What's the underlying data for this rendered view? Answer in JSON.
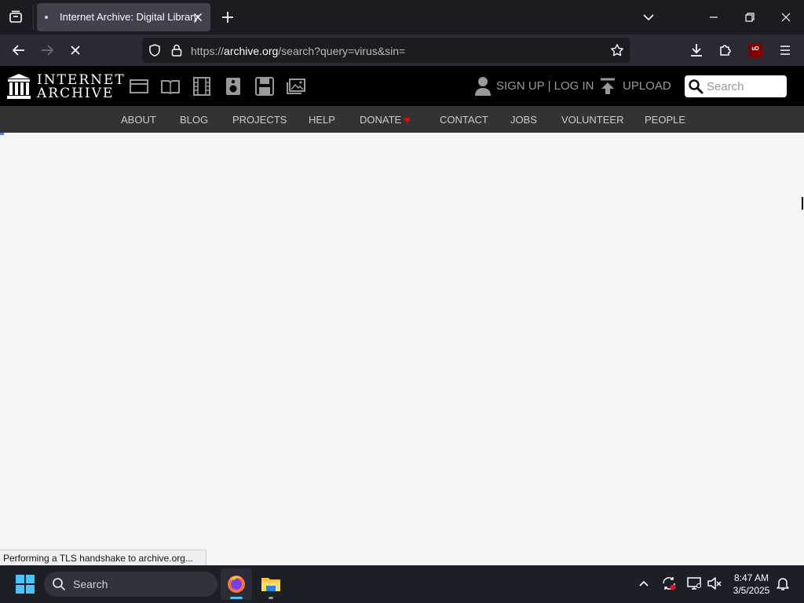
{
  "browser": {
    "tab": {
      "title": "Internet Archive: Digital Library"
    },
    "url": {
      "prefix": "https://",
      "host": "archive.org",
      "path": "/search?query=virus&sin="
    },
    "extension_badge": "uD",
    "status": "Performing a TLS handshake to archive.org..."
  },
  "archive": {
    "logo": {
      "line1": "INTERNET",
      "line2": "ARCHIVE"
    },
    "media_icons": [
      "web-icon",
      "texts-icon",
      "video-icon",
      "audio-icon",
      "software-icon",
      "images-icon"
    ],
    "user": {
      "signup_login": "SIGN UP | LOG IN"
    },
    "upload_label": "UPLOAD",
    "search_placeholder": "Search",
    "topnav": [
      "ABOUT",
      "BLOG",
      "PROJECTS",
      "HELP",
      "DONATE",
      "CONTACT",
      "JOBS",
      "VOLUNTEER",
      "PEOPLE"
    ],
    "donate_heart": "♥"
  },
  "taskbar": {
    "search_label": "Search",
    "time": "8:47 AM",
    "date": "3/5/2025"
  },
  "colors": {
    "tabstrip": "#1c1b22",
    "navbar": "#2b2a33",
    "ia_header": "#000000",
    "ia_topnav": "#333333",
    "heart": "#ff0000",
    "taskbar": "#1c1f26"
  }
}
